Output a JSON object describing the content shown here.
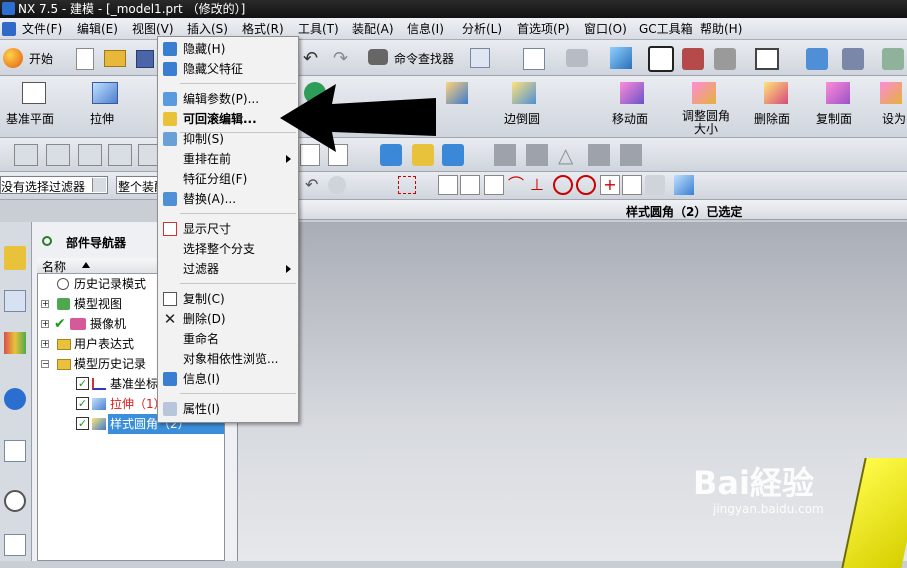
{
  "title": "NX 7.5 - 建模 - [_model1.prt （修改的）]",
  "menubar": [
    "文件(F)",
    "编辑(E)",
    "视图(V)",
    "插入(S)",
    "格式(R)",
    "工具(T)",
    "装配(A)",
    "信息(I)",
    "分析(L)",
    "首选项(P)",
    "窗口(O)",
    "GC工具箱",
    "帮助(H)"
  ],
  "toolbar1": {
    "start": "开始",
    "cmd_finder": "命令查找器"
  },
  "toolbar2": {
    "datum_plane": "基准平面",
    "extrude": "拉伸",
    "edge_blend": "边倒圆",
    "move_face": "移动面",
    "resize_blend": "调整圆角大小",
    "delete_face": "删除面",
    "copy_face": "复制面",
    "set_as": "设为"
  },
  "filter": {
    "selection_filter": "没有选择过滤器",
    "scope": "整个装配"
  },
  "status": "样式圆角（2）已选定",
  "context_menu": [
    {
      "label": "隐藏(H)",
      "icon": "hide-icon"
    },
    {
      "label": "隐藏父特征",
      "icon": "hide-parent-icon"
    },
    {
      "sep": true
    },
    {
      "label": "编辑参数(P)...",
      "icon": "edit-params-icon"
    },
    {
      "label": "可回滚编辑...",
      "icon": "rollback-edit-icon",
      "bold": true
    },
    {
      "sep": true
    },
    {
      "label": "抑制(S)",
      "icon": "suppress-icon"
    },
    {
      "label": "重排在前",
      "submenu": true
    },
    {
      "label": "特征分组(F)"
    },
    {
      "label": "替换(A)...",
      "icon": "replace-icon"
    },
    {
      "sep": true
    },
    {
      "label": "显示尺寸",
      "icon": "show-dims-icon"
    },
    {
      "label": "选择整个分支"
    },
    {
      "label": "过滤器",
      "submenu": true
    },
    {
      "sep": true
    },
    {
      "label": "复制(C)",
      "icon": "copy-icon"
    },
    {
      "label": "删除(D)",
      "icon": "delete-icon"
    },
    {
      "label": "重命名"
    },
    {
      "label": "对象相依性浏览..."
    },
    {
      "label": "信息(I)",
      "icon": "info-icon"
    },
    {
      "sep": true
    },
    {
      "label": "属性(I)",
      "icon": "properties-icon"
    }
  ],
  "navigator": {
    "title": "部件导航器",
    "column": "名称",
    "items": [
      {
        "label": "历史记录模式"
      },
      {
        "label": "模型视图"
      },
      {
        "label": "摄像机"
      },
      {
        "label": "用户表达式"
      },
      {
        "label": "模型历史记录"
      },
      {
        "label": "基准坐标"
      },
      {
        "label": "拉伸（1）"
      },
      {
        "label": "样式圆角（2）"
      }
    ]
  },
  "watermark": {
    "brand": "Bai経验",
    "url": "jingyan.baidu.com"
  },
  "colors": {
    "accent": "#3a8ee6",
    "selected_row": "#3b8ed9",
    "extrude_text": "#d62020",
    "model_yellow": "#e8e400"
  }
}
